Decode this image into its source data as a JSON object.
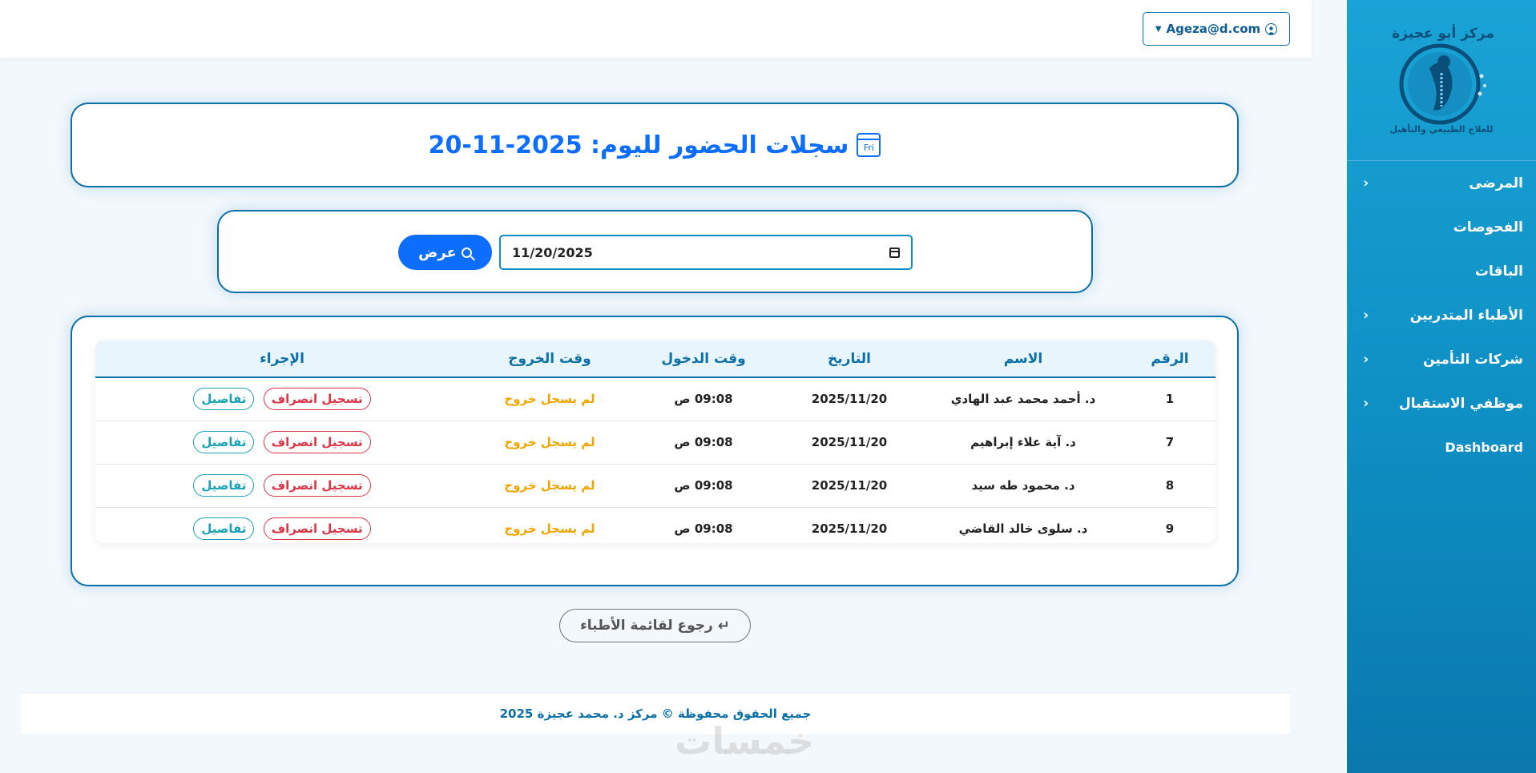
{
  "sidebar": {
    "logo_text_top": "مركز أبو عجيزة",
    "logo_text_bottom": "للعلاج الطبيعي والتأهيل",
    "items": [
      {
        "label": "المرضى",
        "has_submenu": true
      },
      {
        "label": "الفحوصات",
        "has_submenu": false
      },
      {
        "label": "الباقات",
        "has_submenu": false
      },
      {
        "label": "الأطباء المتدربين",
        "has_submenu": true
      },
      {
        "label": "شركات التأمين",
        "has_submenu": true
      },
      {
        "label": "موظفي الاستقبال",
        "has_submenu": true
      },
      {
        "label": "Dashboard",
        "has_submenu": false
      }
    ]
  },
  "topbar": {
    "user_email": "Ageza@d.com"
  },
  "page": {
    "title": "سجلات الحضور لليوم: 2025-11-20",
    "calendar_day": "Fri"
  },
  "filter": {
    "date_value": "11/20/2025",
    "show_label": "عرض"
  },
  "table": {
    "headers": [
      "الرقم",
      "الاسم",
      "التاريخ",
      "وقت الدخول",
      "وقت الخروج",
      "الإجراء"
    ],
    "rows": [
      {
        "id": "1",
        "name": "د. أحمد محمد عبد الهادي",
        "date": "2025/11/20",
        "in": "09:08 ص",
        "out": "لم يسجل خروج",
        "depart": "تسجيل انصراف",
        "details": "تفاصيل"
      },
      {
        "id": "7",
        "name": "د. آية علاء إبراهيم",
        "date": "2025/11/20",
        "in": "09:08 ص",
        "out": "لم يسجل خروج",
        "depart": "تسجيل انصراف",
        "details": "تفاصيل"
      },
      {
        "id": "8",
        "name": "د. محمود طه سيد",
        "date": "2025/11/20",
        "in": "09:08 ص",
        "out": "لم يسجل خروج",
        "depart": "تسجيل انصراف",
        "details": "تفاصيل"
      },
      {
        "id": "9",
        "name": "د. سلوى خالد القاضي",
        "date": "2025/11/20",
        "in": "09:08 ص",
        "out": "لم يسجل خروج",
        "depart": "تسجيل انصراف",
        "details": "تفاصيل"
      }
    ]
  },
  "back_button": "رجوع لقائمة الأطباء",
  "footer": "جميع الحقوق محفوظة © مركز د. محمد عجيزة 2025",
  "watermark": "خمسات",
  "colors": {
    "primary": "#0d6efd",
    "sidebar": "#0e8fc4",
    "border": "#0b6fa8",
    "danger": "#dc3545",
    "info": "#17a2b8",
    "warning": "#f0a500"
  }
}
